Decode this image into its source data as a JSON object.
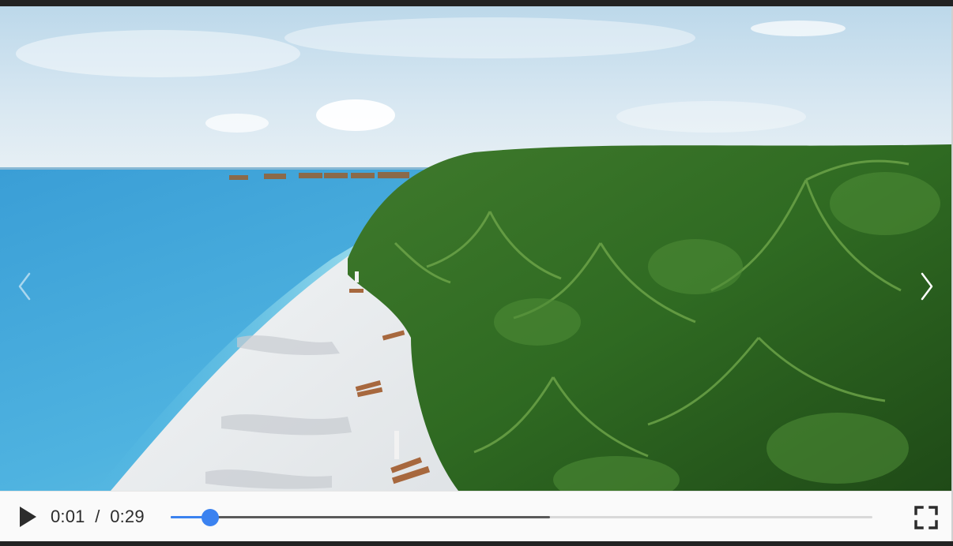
{
  "player": {
    "current_time": "0:01",
    "time_separator": "/",
    "duration": "0:29",
    "played_fraction": 0.056,
    "buffered_fraction": 0.54,
    "icons": {
      "play": "play-icon",
      "fullscreen": "fullscreen-icon",
      "previous": "chevron-left-icon",
      "next": "chevron-right-icon"
    },
    "colors": {
      "accent": "#3b82f0",
      "control_bar": "#fafafa",
      "buffered": "#5a5a5a",
      "track": "#d9d9d9"
    }
  }
}
